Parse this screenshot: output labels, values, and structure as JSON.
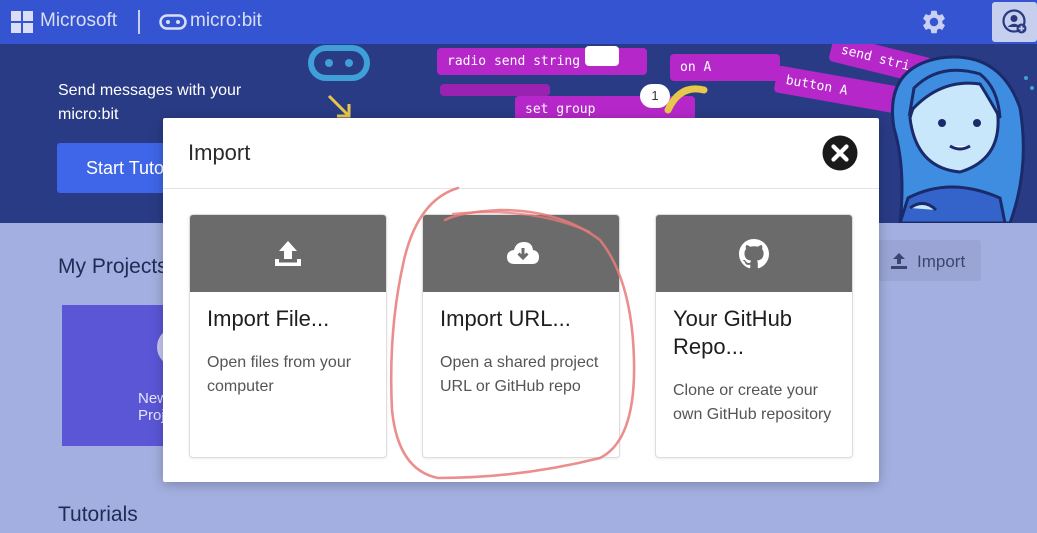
{
  "topbar": {
    "brand": "Microsoft",
    "product": "micro:bit"
  },
  "hero": {
    "text": "Send messages with your micro:bit",
    "button_label": "Start Tutorial",
    "blocks": [
      "radio send string",
      "on A",
      "button A",
      "send stri",
      "set group",
      "1"
    ]
  },
  "page": {
    "my_projects": "My Projects",
    "new_project": "New Project",
    "import_label": "Import",
    "tutorials": "Tutorials"
  },
  "modal": {
    "title": "Import",
    "options": [
      {
        "title": "Import File...",
        "description": "Open files from your computer",
        "icon": "upload-icon"
      },
      {
        "title": "Import URL...",
        "description": "Open a shared project URL or GitHub repo",
        "icon": "cloud-download-icon"
      },
      {
        "title": "Your GitHub Repo...",
        "description": "Clone or create your own GitHub repository",
        "icon": "github-icon"
      }
    ]
  },
  "colors": {
    "topbar": "#3454d1",
    "hero": "#2a3b86",
    "accent_button": "#3f66e8",
    "block": "#b627c9",
    "card_header": "#6b6b6b",
    "annotation": "#e87a7a"
  }
}
